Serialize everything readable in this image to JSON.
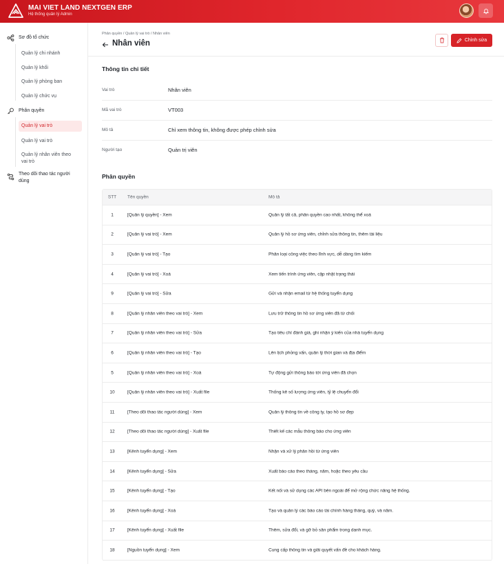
{
  "header": {
    "title": "MAI VIET LAND NEXTGEN ERP",
    "subtitle": "Hệ thống quản lý Admin"
  },
  "sidebar": {
    "groups": [
      {
        "label": "Sơ đồ tổ chức",
        "icon": "org-chart-icon",
        "items": [
          "Quản lý chi nhánh",
          "Quản lý khối",
          "Quản lý phòng ban",
          "Quản lý chức vụ"
        ]
      },
      {
        "label": "Phân quyền",
        "icon": "key-icon",
        "items": [
          "Quản lý vai trò",
          "Quản lý vai trò",
          "Quản lý nhân viên theo vai trò"
        ]
      },
      {
        "label": "Theo dõi thao tác người dùng",
        "icon": "route-icon",
        "items": []
      }
    ],
    "active_item": "Quản lý vai trò"
  },
  "page": {
    "breadcrumb": "Phân quyền / Quản lý vai trò / Nhân viên",
    "title": "Nhân viên",
    "edit_label": "Chỉnh sửa"
  },
  "details": {
    "section_title": "Thông tin chi tiết",
    "rows": [
      {
        "label": "Vai trò",
        "value": "Nhân viên"
      },
      {
        "label": "Mã vai trò",
        "value": "VT003"
      },
      {
        "label": "Mô tả",
        "value": "Chỉ xem thông tin, không được phép chỉnh sửa"
      },
      {
        "label": "Người tạo",
        "value": "Quản trị viên"
      }
    ]
  },
  "permissions": {
    "section_title": "Phân quyền",
    "columns": [
      "STT",
      "Tên quyền",
      "Mô tả"
    ],
    "rows": [
      {
        "stt": "1",
        "name": "[Quản lý quyền] - Xem",
        "desc": "Quản lý tất cả, phân quyền cao nhất, không thể xoá"
      },
      {
        "stt": "2",
        "name": "[Quản lý vai trò] - Xem",
        "desc": "Quản lý hồ sơ ứng viên, chỉnh sửa thông tin, thêm tài liệu"
      },
      {
        "stt": "3",
        "name": "[Quản lý vai trò] - Tạo",
        "desc": "Phân loại công việc theo lĩnh vực, dễ dàng tìm kiếm"
      },
      {
        "stt": "4",
        "name": "[Quản lý vai trò] - Xoá",
        "desc": "Xem tiến trình ứng viên, cập nhật trạng thái"
      },
      {
        "stt": "9",
        "name": "[Quản lý vai trò] - Sửa",
        "desc": "Gửi và nhận email từ hệ thống tuyển dụng"
      },
      {
        "stt": "8",
        "name": "[Quản lý nhân viên theo vai trò] - Xem",
        "desc": "Lưu trữ thông tin hồ sơ ứng viên đã từ chối"
      },
      {
        "stt": "7",
        "name": "[Quản lý nhân viên theo vai trò] - Sửa",
        "desc": "Tạo tiêu chí đánh giá, ghi nhận ý kiến của nhà tuyển dụng"
      },
      {
        "stt": "6",
        "name": "[Quản lý nhân viên theo vai trò] - Tạo",
        "desc": "Lên lịch phỏng vấn, quản lý thời gian và địa điểm"
      },
      {
        "stt": "5",
        "name": "[Quản lý nhân viên theo vai trò] - Xoá",
        "desc": "Tự động gửi thông báo tới ứng viên đã chọn"
      },
      {
        "stt": "10",
        "name": "[Quản lý nhân viên theo vai trò] - Xuất file",
        "desc": "Thống kê số lượng ứng viên, tỷ lệ chuyển đổi"
      },
      {
        "stt": "11",
        "name": "[Theo dõi thao tác người dùng] - Xem",
        "desc": "Quản lý thông tin về công ty, tạo hồ sơ đẹp"
      },
      {
        "stt": "12",
        "name": "[Theo dõi thao tác người dùng] - Xuất file",
        "desc": "Thiết kế các mẫu thông báo cho ứng viên"
      },
      {
        "stt": "13",
        "name": "[Kênh tuyển dụng] - Xem",
        "desc": "Nhận và xử lý phản hồi từ ứng viên"
      },
      {
        "stt": "14",
        "name": "[Kênh tuyển dụng] - Sửa",
        "desc": "Xuất báo cáo theo tháng, năm, hoặc theo yêu cầu"
      },
      {
        "stt": "15",
        "name": "[Kênh tuyển dụng] - Tạo",
        "desc": "Kết nối và sử dụng các API bên ngoài để mở rộng chức năng hệ thống."
      },
      {
        "stt": "16",
        "name": "[Kênh tuyển dụng] - Xoá",
        "desc": "Tạo và quản lý các báo cáo tài chính hàng tháng, quý, và năm."
      },
      {
        "stt": "17",
        "name": "[Kênh tuyển dụng] - Xuất file",
        "desc": "Thêm, sửa đổi, và gỡ bỏ sản phẩm trong danh mục."
      },
      {
        "stt": "18",
        "name": "[Nguồn tuyển dụng] - Xem",
        "desc": "Cung cấp thông tin và giải quyết vấn đề cho khách hàng."
      }
    ]
  }
}
